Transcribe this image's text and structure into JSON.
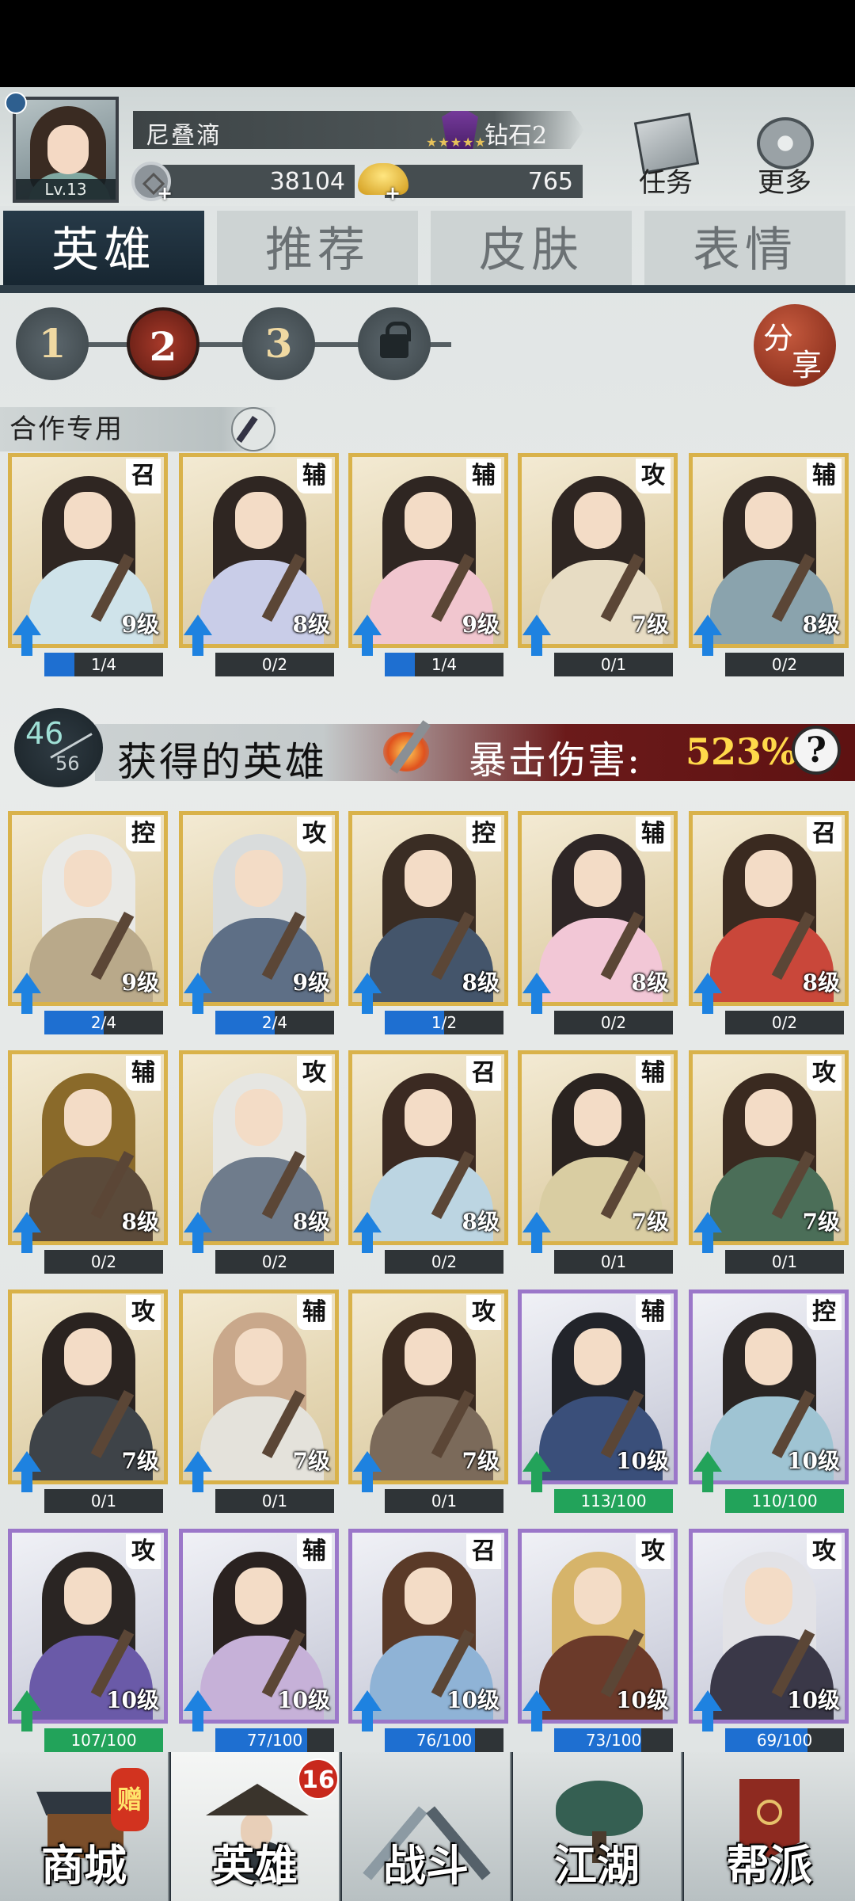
{
  "player": {
    "name": "尼叠滴",
    "level": "Lv.13",
    "rank": "钻石2",
    "rank_stars": "★★★★★",
    "coins": "38104",
    "gold": "765"
  },
  "header_buttons": {
    "tasks": "任务",
    "more": "更多"
  },
  "tabs": [
    "英雄",
    "推荐",
    "皮肤",
    "表情"
  ],
  "pages": [
    "1",
    "2",
    "3"
  ],
  "share": {
    "l1": "分",
    "l2": "享"
  },
  "coop": {
    "label": "合作专用",
    "cards": [
      {
        "role": "召",
        "level": "9级",
        "progress": "1/4",
        "fill": 0.25,
        "robe": "#cfe3ea"
      },
      {
        "role": "辅",
        "level": "8级",
        "progress": "0/2",
        "fill": 0.0,
        "robe": "#c9cde8"
      },
      {
        "role": "辅",
        "level": "9级",
        "progress": "1/4",
        "fill": 0.25,
        "robe": "#f1c6cf"
      },
      {
        "role": "攻",
        "level": "7级",
        "progress": "0/1",
        "fill": 0.0,
        "robe": "#e7dcc3"
      },
      {
        "role": "辅",
        "level": "8级",
        "progress": "0/2",
        "fill": 0.0,
        "robe": "#8aa3ad"
      }
    ]
  },
  "heroes": {
    "owned": "46",
    "total": "56",
    "title": "获得的英雄",
    "crit_label": "暴击伤害:",
    "crit_value": "523%",
    "help": "?"
  },
  "hero_cards": [
    {
      "role": "控",
      "level": "9级",
      "progress": "2/4",
      "fill": 0.5,
      "robe": "#b9a98a",
      "hair": "#e9e9e6",
      "tier": "gold",
      "up": "blue"
    },
    {
      "role": "攻",
      "level": "9级",
      "progress": "2/4",
      "fill": 0.5,
      "robe": "#5e6f86",
      "hair": "#d9dcdc",
      "tier": "gold",
      "up": "blue"
    },
    {
      "role": "控",
      "level": "8级",
      "progress": "1/2",
      "fill": 0.5,
      "robe": "#44556b",
      "hair": "#3a2d24",
      "tier": "gold",
      "up": "blue"
    },
    {
      "role": "辅",
      "level": "8级",
      "progress": "0/2",
      "fill": 0.0,
      "robe": "#f2c7d6",
      "hair": "#2e2626",
      "tier": "gold",
      "up": "blue"
    },
    {
      "role": "召",
      "level": "8级",
      "progress": "0/2",
      "fill": 0.0,
      "robe": "#c9473a",
      "hair": "#3a2a20",
      "tier": "gold",
      "up": "blue"
    },
    {
      "role": "辅",
      "level": "8级",
      "progress": "0/2",
      "fill": 0.0,
      "robe": "#5b4a3a",
      "hair": "#8a6a2a",
      "tier": "gold",
      "up": "blue"
    },
    {
      "role": "攻",
      "level": "8级",
      "progress": "0/2",
      "fill": 0.0,
      "robe": "#6f7c8c",
      "hair": "#e6e6e2",
      "tier": "gold",
      "up": "blue"
    },
    {
      "role": "召",
      "level": "8级",
      "progress": "0/2",
      "fill": 0.0,
      "robe": "#bcd5e2",
      "hair": "#3b2a22",
      "tier": "gold",
      "up": "blue"
    },
    {
      "role": "辅",
      "level": "7级",
      "progress": "0/1",
      "fill": 0.0,
      "robe": "#d9cda2",
      "hair": "#2a2320",
      "tier": "gold",
      "up": "blue"
    },
    {
      "role": "攻",
      "level": "7级",
      "progress": "0/1",
      "fill": 0.0,
      "robe": "#4b6e58",
      "hair": "#3a2a20",
      "tier": "gold",
      "up": "blue"
    },
    {
      "role": "攻",
      "level": "7级",
      "progress": "0/1",
      "fill": 0.0,
      "robe": "#3e4348",
      "hair": "#2a2320",
      "tier": "gold",
      "up": "blue"
    },
    {
      "role": "辅",
      "level": "7级",
      "progress": "0/1",
      "fill": 0.0,
      "robe": "#e4e2db",
      "hair": "#c9a88b",
      "tier": "gold",
      "up": "blue"
    },
    {
      "role": "攻",
      "level": "7级",
      "progress": "0/1",
      "fill": 0.0,
      "robe": "#7b6a5a",
      "hair": "#3a2a20",
      "tier": "gold",
      "up": "blue"
    },
    {
      "role": "辅",
      "level": "10级",
      "progress": "113/100",
      "fill": 1.0,
      "robe": "#3a4f7a",
      "hair": "#22242a",
      "tier": "purple",
      "up": "green"
    },
    {
      "role": "控",
      "level": "10级",
      "progress": "110/100",
      "fill": 1.0,
      "robe": "#9fc4d3",
      "hair": "#2a2523",
      "tier": "purple",
      "up": "green"
    },
    {
      "role": "攻",
      "level": "10级",
      "progress": "107/100",
      "fill": 1.0,
      "robe": "#6a5aa8",
      "hair": "#2a2523",
      "tier": "purple",
      "up": "green"
    },
    {
      "role": "辅",
      "level": "10级",
      "progress": "77/100",
      "fill": 0.77,
      "robe": "#c6b1d8",
      "hair": "#2a2220",
      "tier": "purple",
      "up": "blue"
    },
    {
      "role": "召",
      "level": "10级",
      "progress": "76/100",
      "fill": 0.76,
      "robe": "#8fb3d6",
      "hair": "#5a3a28",
      "tier": "purple",
      "up": "blue"
    },
    {
      "role": "攻",
      "level": "10级",
      "progress": "73/100",
      "fill": 0.73,
      "robe": "#6b3a2a",
      "hair": "#d6b46a",
      "tier": "purple",
      "up": "blue"
    },
    {
      "role": "攻",
      "level": "10级",
      "progress": "69/100",
      "fill": 0.69,
      "robe": "#3a3848",
      "hair": "#e2e2e6",
      "tier": "purple",
      "up": "blue"
    }
  ],
  "nav": [
    {
      "label": "商城",
      "icon": "shop-icon",
      "tag": "赠"
    },
    {
      "label": "英雄",
      "icon": "hero-icon",
      "badge": "16"
    },
    {
      "label": "战斗",
      "icon": "swords-icon"
    },
    {
      "label": "江湖",
      "icon": "world-tree-icon"
    },
    {
      "label": "帮派",
      "icon": "guild-banner-icon"
    }
  ]
}
